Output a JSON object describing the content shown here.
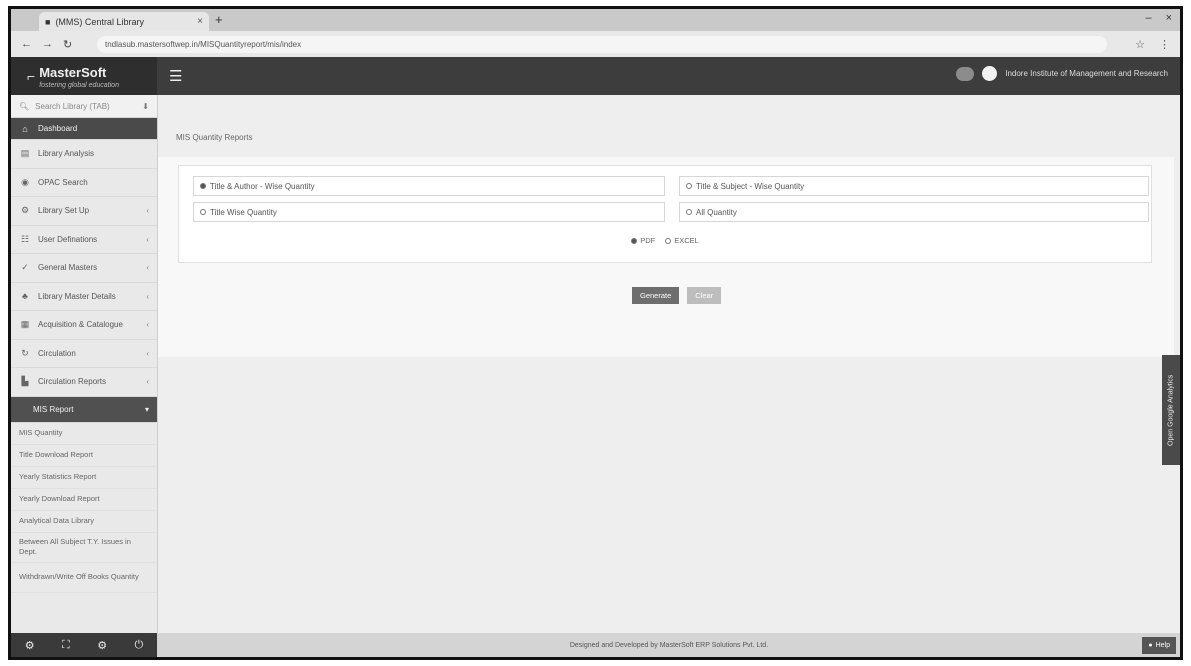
{
  "browser": {
    "tab_title": "(MMS) Central Library",
    "tab_close": "×",
    "new_tab": "+",
    "window_controls": [
      "–",
      "×"
    ],
    "url": "tndlasub.mastersoftwep.in/MISQuantityreport/mis/index",
    "nav": [
      "←",
      "→",
      "↻"
    ],
    "icons": [
      "☆",
      "⋮"
    ]
  },
  "header": {
    "logo_name": "MasterSoft",
    "logo_tagline": "fostering global education",
    "user": "Indore Institute of Management and Research"
  },
  "sidebar": {
    "search_placeholder": "Search Library (TAB)",
    "items": [
      {
        "label": "Dashboard",
        "icon": "dashboard-icon"
      },
      {
        "label": "Library Analysis",
        "icon": "analysis-icon"
      },
      {
        "label": "OPAC Search",
        "icon": "search-icon"
      },
      {
        "label": "Library Set Up",
        "icon": "setup-icon"
      },
      {
        "label": "User Definations",
        "icon": "user-icon"
      },
      {
        "label": "General Masters",
        "icon": "masters-icon"
      },
      {
        "label": "Library Master Details",
        "icon": "details-icon"
      },
      {
        "label": "Acquisition & Catalogue",
        "icon": "catalogue-icon"
      },
      {
        "label": "Circulation",
        "icon": "circulation-icon"
      },
      {
        "label": "Circulation Reports",
        "icon": "reports-icon"
      }
    ],
    "mis_label": "MIS Report",
    "mis_sub": [
      "MIS Quantity",
      "Title Download Report",
      "Yearly Statistics Report",
      "Yearly Download Report",
      "Analytical Data Library",
      "Between All Subject T.Y. Issues in Dept.",
      "Withdrawn/Write Off Books Quantity"
    ],
    "footer_icons": [
      "⚙",
      "⛶",
      "⚙",
      "⏻"
    ]
  },
  "main": {
    "breadcrumb": "MIS Quantity Reports",
    "options": [
      {
        "label": "Title & Author - Wise Quantity",
        "selected": true
      },
      {
        "label": "Title & Subject - Wise Quantity",
        "selected": false
      },
      {
        "label": "Title Wise Quantity",
        "selected": false
      },
      {
        "label": "All Quantity",
        "selected": false
      }
    ],
    "format_pdf": "PDF",
    "format_excel": "EXCEL",
    "generate_label": "Generate",
    "clear_label": "Clear",
    "side_tab": "Open Google Analytics",
    "help_label": "Help",
    "footer_text": "Designed and Developed by MasterSoft ERP Solutions Pvt. Ltd."
  }
}
